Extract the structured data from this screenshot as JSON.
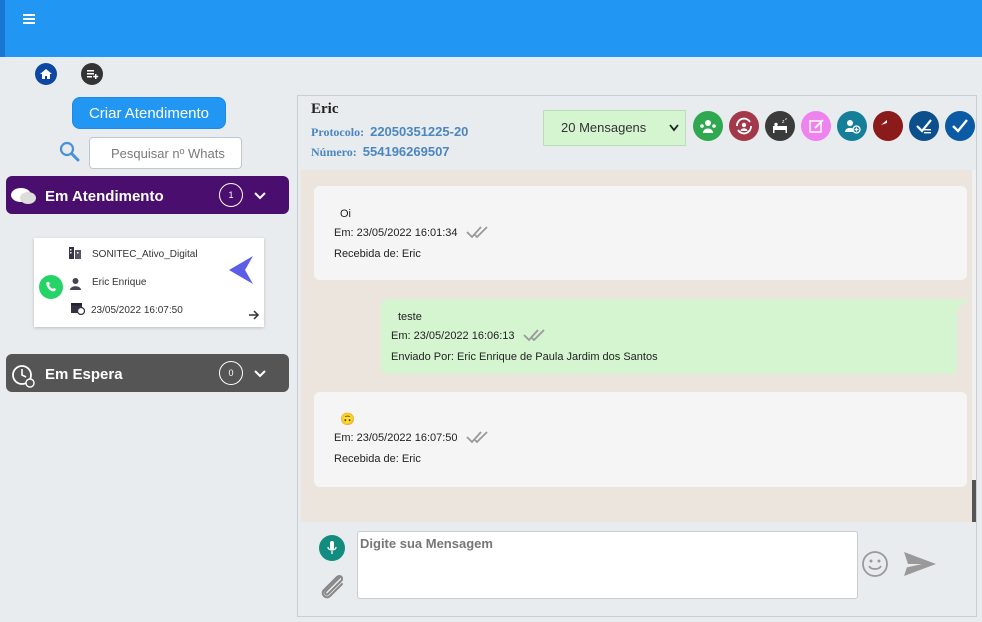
{
  "header": {
    "menu_icon": "hamburger-icon",
    "color": "#2196f3"
  },
  "sidebar": {
    "home_icon": "home-icon",
    "playlist_icon": "playlist-add-icon",
    "create_button": "Criar Atendimento",
    "search_placeholder": "Pesquisar nº Whats",
    "em_atendimento": {
      "label": "Em Atendimento",
      "count": "1",
      "color": "#4a0f6e"
    },
    "em_espera": {
      "label": "Em Espera",
      "count": "0",
      "color": "#555555"
    },
    "card": {
      "company": "SONITEC_Ativo_Digital",
      "agent": "Eric Enrique",
      "datetime": "23/05/2022 16:07:50"
    }
  },
  "chat": {
    "contact": "Eric",
    "protocol_label": "Protocolo:",
    "protocol_value": "22050351225-20",
    "number_label": "Número:",
    "number_value": "554196269507",
    "messages_select": "20 Mensagens",
    "actions": [
      {
        "name": "transfer-icon",
        "color": "#2fa84f"
      },
      {
        "name": "sync-user-icon",
        "color": "#a3384a"
      },
      {
        "name": "sleep-icon",
        "color": "#3b3b3b"
      },
      {
        "name": "note-edit-icon",
        "color": "#ee82ee"
      },
      {
        "name": "add-user-icon",
        "color": "#157f9a"
      },
      {
        "name": "reply-icon",
        "color": "#8b1a1a"
      },
      {
        "name": "checklist-icon",
        "color": "#0b4f8c"
      },
      {
        "name": "check-icon",
        "color": "#0b5aa6"
      }
    ],
    "messages": [
      {
        "text": "Oi",
        "time": "Em: 23/05/2022 16:01:34",
        "from": "Recebida de: Eric"
      },
      {
        "text": "teste",
        "time": "Em: 23/05/2022 16:06:13",
        "from": "Enviado Por: Eric Enrique de Paula Jardim dos Santos"
      },
      {
        "text": "🙃",
        "time": "Em: 23/05/2022 16:07:50",
        "from": "Recebida de: Eric"
      }
    ],
    "input_placeholder": "Digite sua Mensagem"
  }
}
